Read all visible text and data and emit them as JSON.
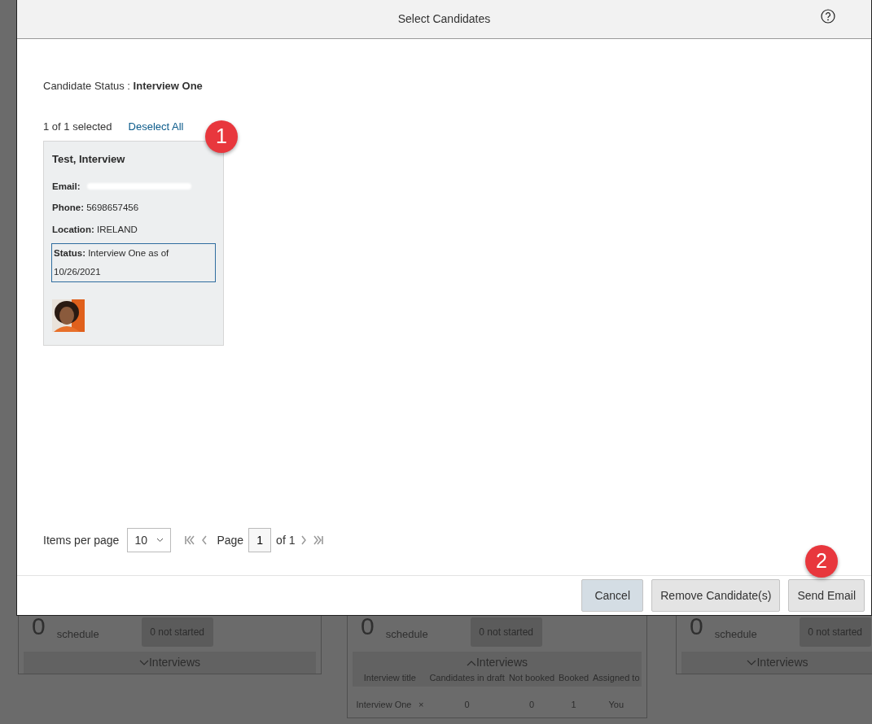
{
  "background": {
    "cards": [
      {
        "count": "0",
        "count_label": "schedule",
        "status_button": "0 not started",
        "toggle": "Interviews",
        "expanded": false
      },
      {
        "count": "0",
        "count_label": "schedule",
        "status_button": "0 not started",
        "toggle": "Interviews",
        "expanded": true,
        "table": {
          "columns": [
            "Interview title",
            "Candidates in draft",
            "Not booked",
            "Booked",
            "Assigned to"
          ],
          "rows": [
            {
              "cells": [
                "Interview One",
                "0",
                "0",
                "1",
                "You"
              ],
              "remove": "×"
            }
          ]
        }
      },
      {
        "count": "0",
        "count_label": "schedule",
        "status_button": "0 not started",
        "toggle": "Interviews",
        "expanded": false
      }
    ]
  },
  "dialog": {
    "title": "Select Candidates",
    "status_label": "Candidate Status :",
    "status_value": "Interview One",
    "selection_count": "1 of 1 selected",
    "deselect_link": "Deselect All",
    "candidates": [
      {
        "name": "Test, Interview",
        "selected": true,
        "fields": [
          {
            "label": "Email:",
            "redacted": true,
            "focused": false
          },
          {
            "label": "Phone:",
            "value": "5698657456",
            "focused": false
          },
          {
            "label": "Location:",
            "value": "IRELAND",
            "focused": false
          },
          {
            "label": "Status:",
            "value": "Interview One as of 10/26/2021",
            "focused": true
          }
        ]
      }
    ],
    "pagination": {
      "items_label": "Items per page",
      "items_value": "10",
      "page_label": "Page",
      "page_value": "1",
      "of_label": "of 1"
    },
    "buttons": [
      {
        "label": "Cancel",
        "kind": "emphasized"
      },
      {
        "label": "Remove Candidate(s)",
        "kind": "default"
      },
      {
        "label": "Send Email",
        "kind": "default"
      }
    ]
  },
  "annotations": [
    {
      "label": "1"
    },
    {
      "label": "2"
    }
  ]
}
